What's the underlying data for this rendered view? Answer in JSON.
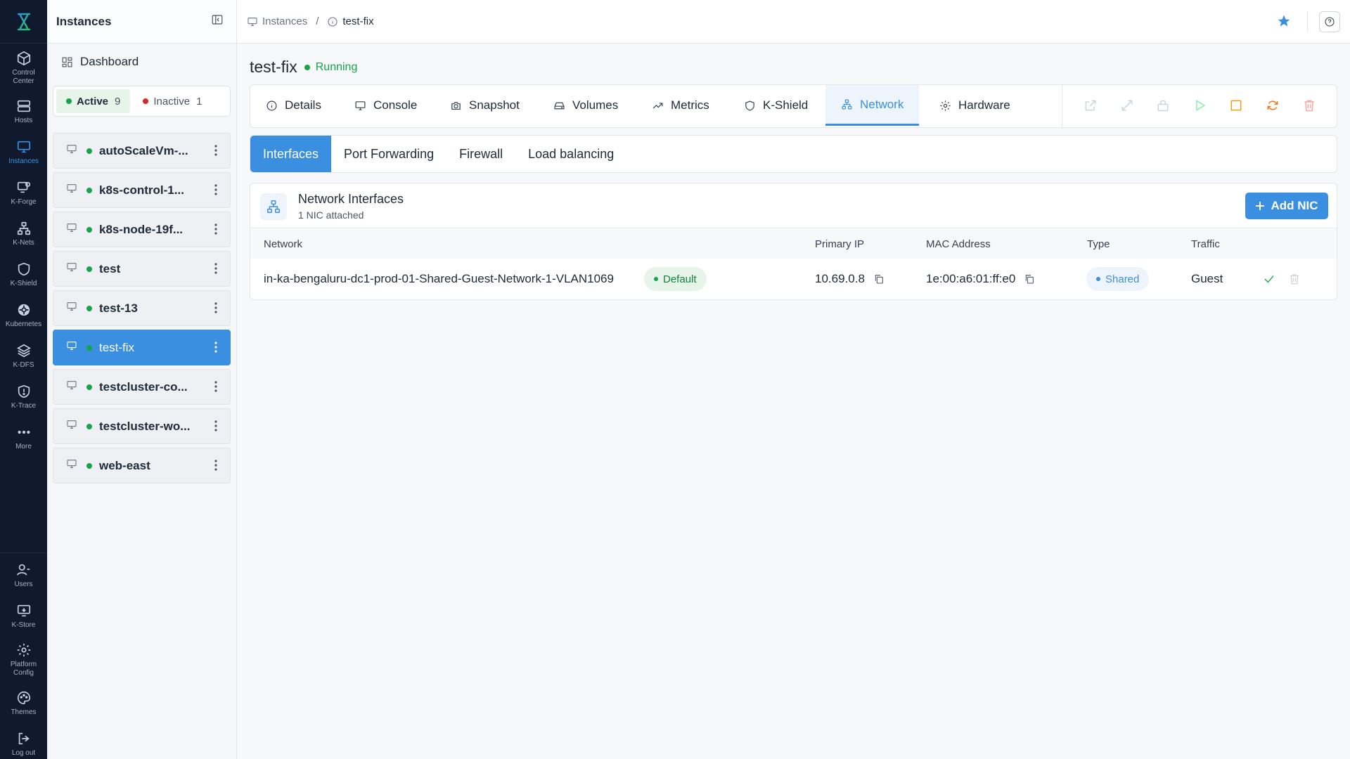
{
  "rail": {
    "items": [
      {
        "label": "Control Center",
        "icon": "cube-icon"
      },
      {
        "label": "Hosts",
        "icon": "server-icon"
      },
      {
        "label": "Instances",
        "icon": "monitor-icon",
        "active": true
      },
      {
        "label": "K-Forge",
        "icon": "forge-icon"
      },
      {
        "label": "K-Nets",
        "icon": "network-icon"
      },
      {
        "label": "K-Shield",
        "icon": "shield-icon"
      },
      {
        "label": "Kubernetes",
        "icon": "helm-icon"
      },
      {
        "label": "K-DFS",
        "icon": "layers-icon"
      },
      {
        "label": "K-Trace",
        "icon": "trace-icon"
      },
      {
        "label": "More",
        "icon": "more-icon"
      },
      {
        "label": "Users",
        "icon": "users-icon"
      },
      {
        "label": "K-Store",
        "icon": "store-icon"
      },
      {
        "label": "Platform Config",
        "icon": "gear-icon"
      },
      {
        "label": "Themes",
        "icon": "palette-icon"
      },
      {
        "label": "Log out",
        "icon": "logout-icon"
      }
    ],
    "accent": "#3b8fe0"
  },
  "sidebar": {
    "title": "Instances",
    "dashboard_label": "Dashboard",
    "filter": {
      "active_label": "Active",
      "active_count": "9",
      "inactive_label": "Inactive",
      "inactive_count": "1"
    },
    "instances": [
      "autoScaleVm-...",
      "k8s-control-1...",
      "k8s-node-19f...",
      "test",
      "test-13",
      "test-fix",
      "testcluster-co...",
      "testcluster-wo...",
      "web-east"
    ],
    "selected": "test-fix"
  },
  "breadcrumb": {
    "root": "Instances",
    "separator": "/",
    "current": "test-fix"
  },
  "page": {
    "title": "test-fix",
    "status": "Running",
    "status_color": "#16a34a"
  },
  "tabs": [
    {
      "label": "Details",
      "icon": "info-icon"
    },
    {
      "label": "Console",
      "icon": "monitor-icon"
    },
    {
      "label": "Snapshot",
      "icon": "camera-icon"
    },
    {
      "label": "Volumes",
      "icon": "drive-icon"
    },
    {
      "label": "Metrics",
      "icon": "trend-icon"
    },
    {
      "label": "K-Shield",
      "icon": "shield-icon"
    },
    {
      "label": "Network",
      "icon": "network-icon",
      "active": true
    },
    {
      "label": "Hardware",
      "icon": "gear-icon"
    }
  ],
  "subtabs": [
    "Interfaces",
    "Port Forwarding",
    "Firewall",
    "Load balancing"
  ],
  "nic": {
    "title": "Network Interfaces",
    "subtitle": "1 NIC attached",
    "add_label": "Add NIC",
    "columns": [
      "Network",
      "Primary IP",
      "MAC Address",
      "Type",
      "Traffic"
    ],
    "rows": [
      {
        "network": "in-ka-bengaluru-dc1-prod-01-Shared-Guest-Network-1-VLAN1069",
        "badge": "Default",
        "ip": "10.69.0.8",
        "mac": "1e:00:a6:01:ff:e0",
        "type": "Shared",
        "traffic": "Guest"
      }
    ]
  }
}
